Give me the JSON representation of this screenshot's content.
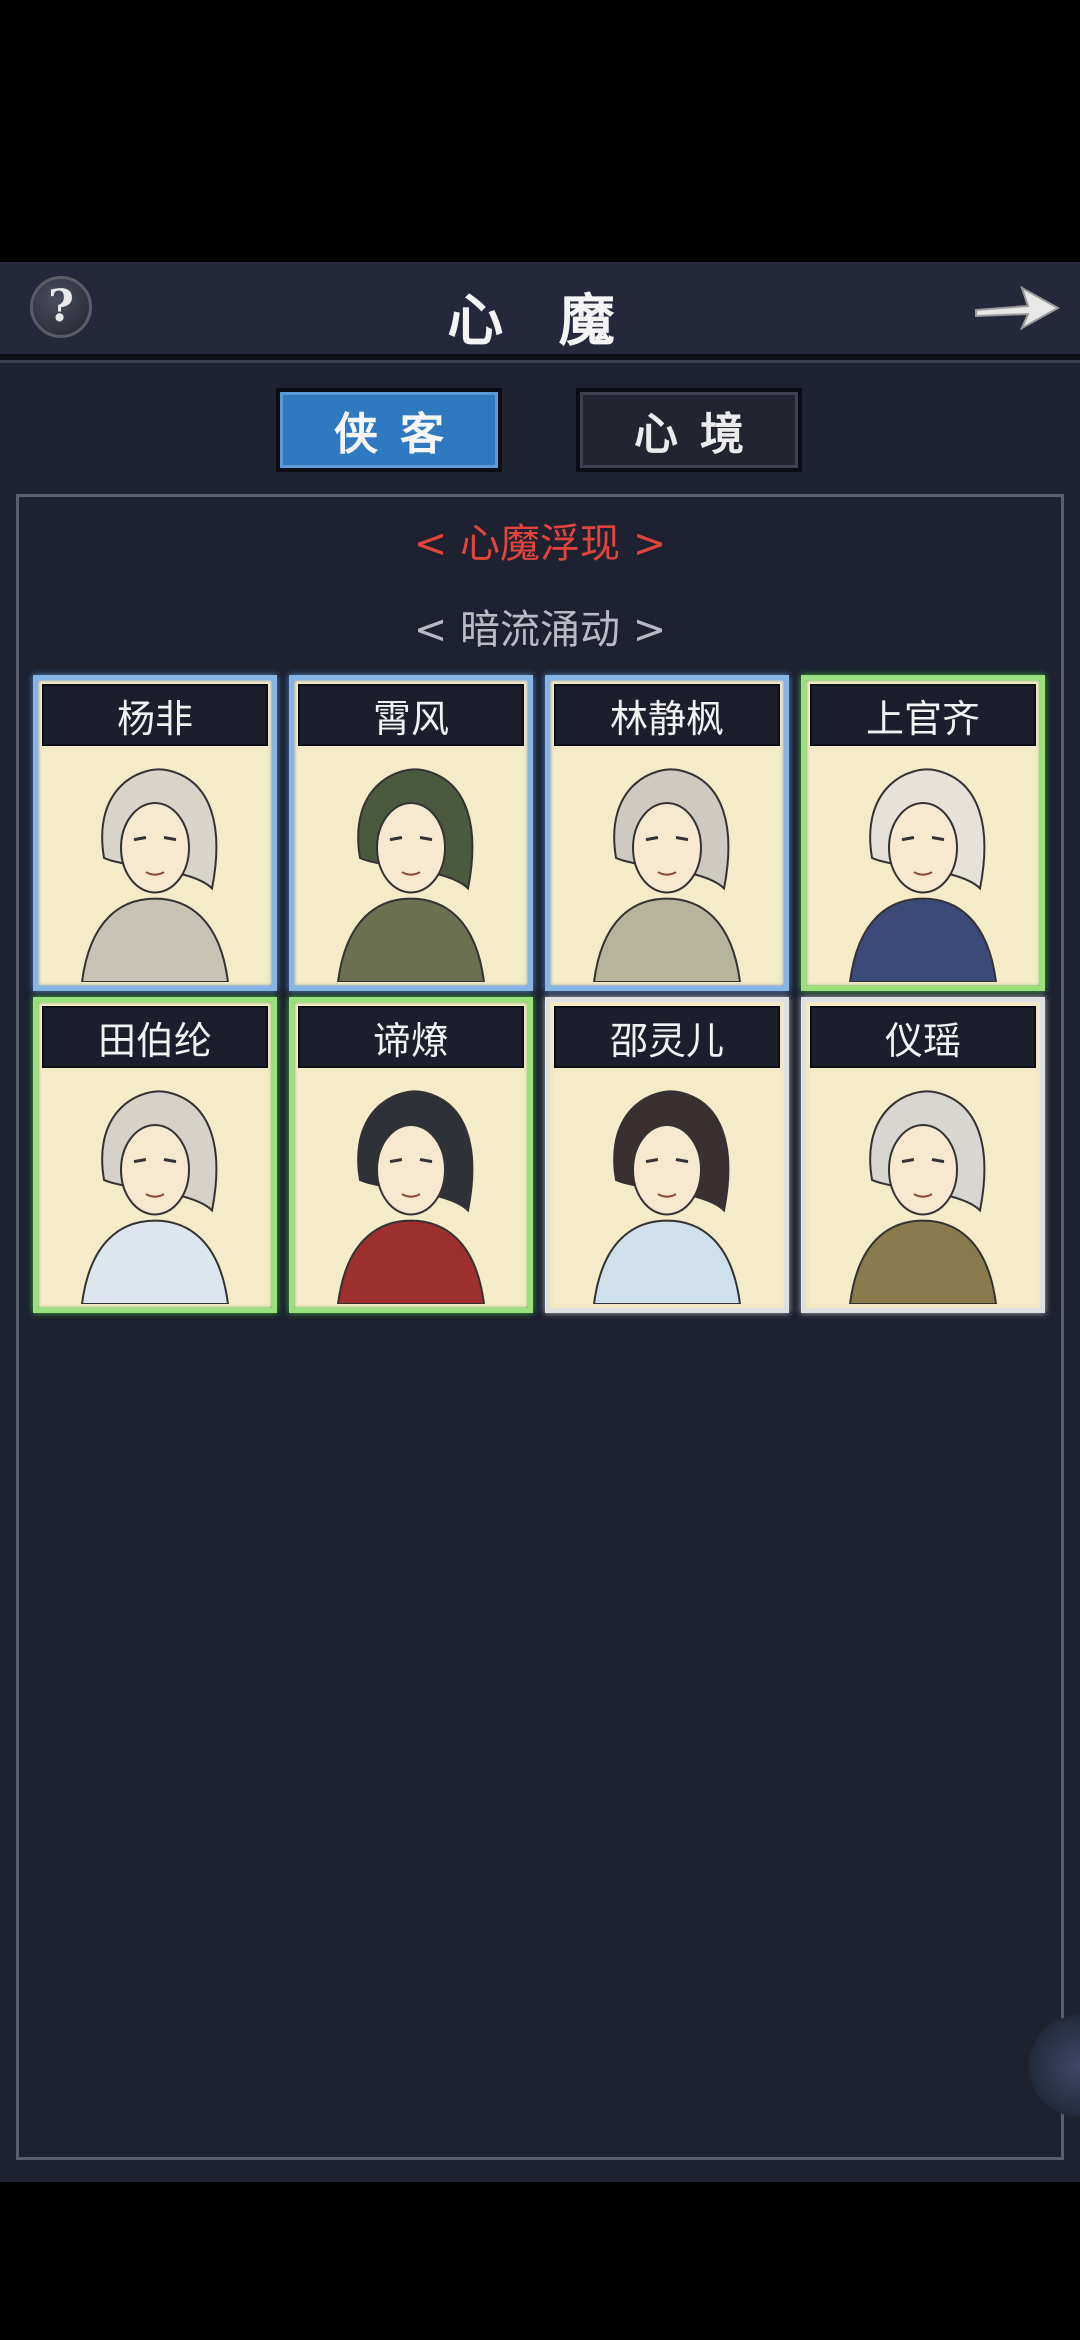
{
  "header": {
    "title": "心 魔",
    "help_icon": "question-mark-icon",
    "next_icon": "arrow-right-icon"
  },
  "tabs": [
    {
      "label": "侠客",
      "active": true
    },
    {
      "label": "心境",
      "active": false
    }
  ],
  "panel": {
    "section_active": "< 心魔浮现 >",
    "section_secondary": "< 暗流涌动 >"
  },
  "characters": [
    {
      "name": "杨非",
      "rarity_color": "blue"
    },
    {
      "name": "霄风",
      "rarity_color": "blue"
    },
    {
      "name": "林静枫",
      "rarity_color": "blue"
    },
    {
      "name": "上官齐",
      "rarity_color": "green"
    },
    {
      "name": "田伯纶",
      "rarity_color": "green"
    },
    {
      "name": "谛燎",
      "rarity_color": "green"
    },
    {
      "name": "邵灵儿",
      "rarity_color": "white"
    },
    {
      "name": "仪瑶",
      "rarity_color": "white"
    }
  ],
  "colors": {
    "active_tab": "#2f79c0",
    "section_red": "#e0443d",
    "rarity_blue": "#88b4e4",
    "rarity_green": "#9ae07d",
    "rarity_white": "#dfe0e2"
  }
}
